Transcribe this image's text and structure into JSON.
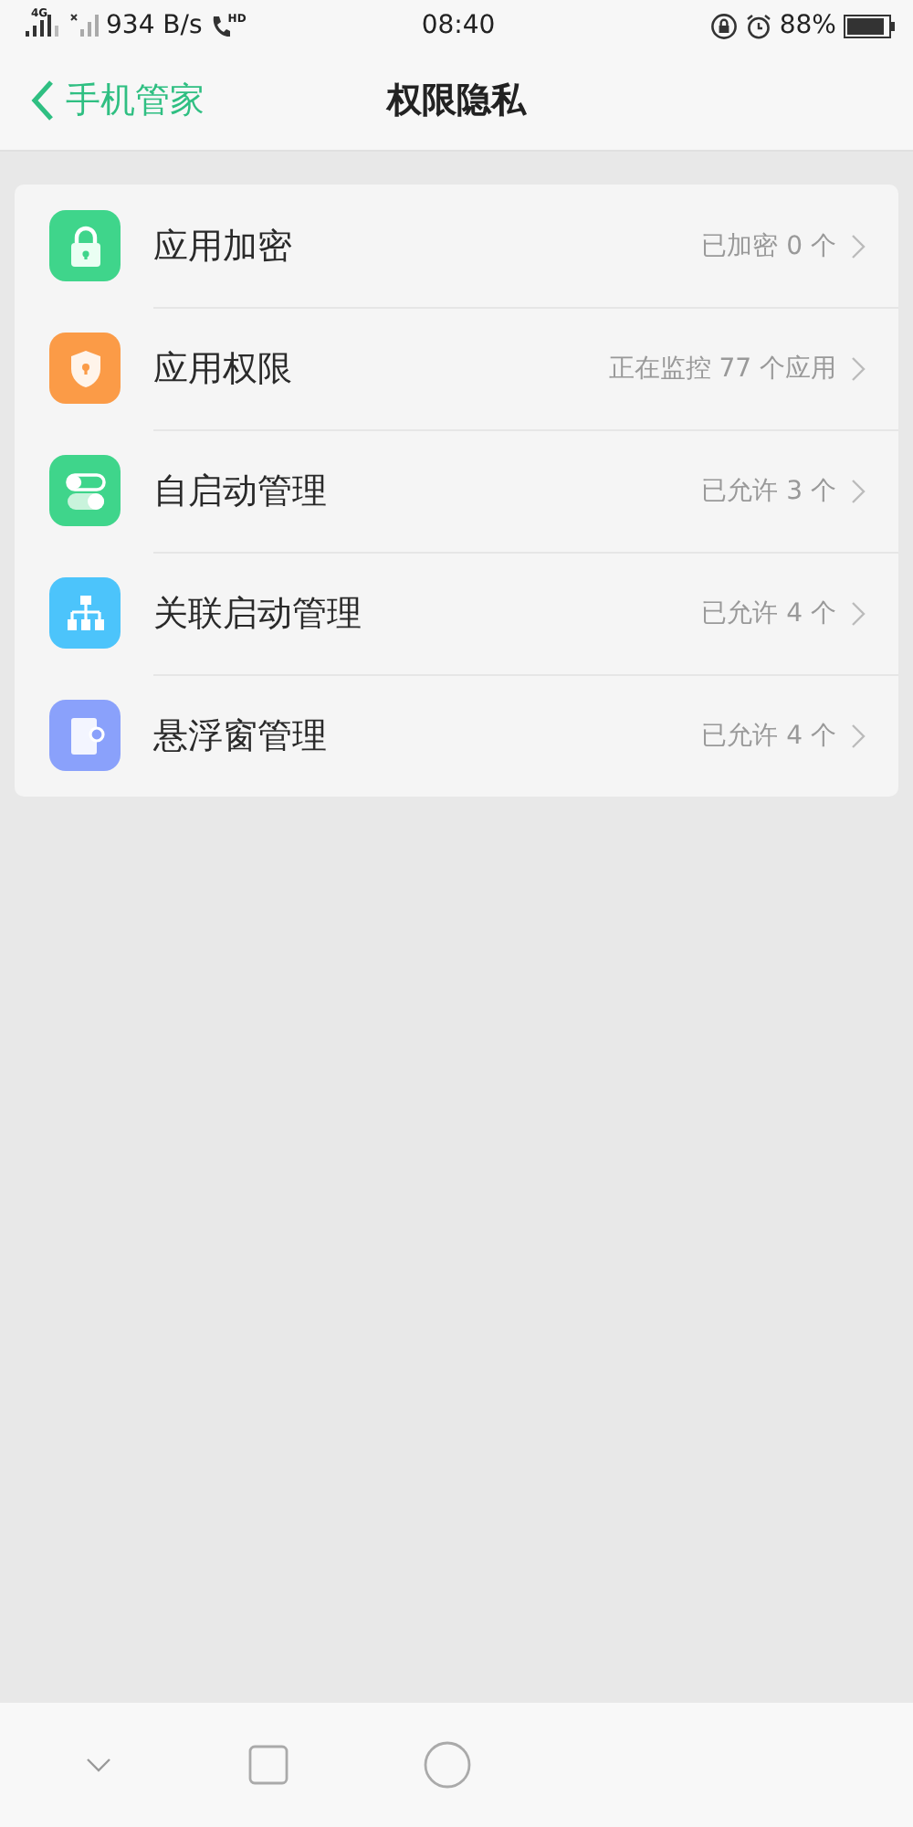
{
  "status_bar": {
    "network": "4G",
    "speed": "934 B/s",
    "call": "HD",
    "time": "08:40",
    "battery": "88%"
  },
  "header": {
    "back": "手机管家",
    "title": "权限隐私"
  },
  "items": [
    {
      "kind": "lock",
      "label": "应用加密",
      "value": "已加密 0 个"
    },
    {
      "kind": "shield",
      "label": "应用权限",
      "value": "正在监控 77 个应用"
    },
    {
      "kind": "toggle",
      "label": "自启动管理",
      "value": "已允许 3 个"
    },
    {
      "kind": "tree",
      "label": "关联启动管理",
      "value": "已允许 4 个"
    },
    {
      "kind": "window",
      "label": "悬浮窗管理",
      "value": "已允许 4 个"
    }
  ]
}
